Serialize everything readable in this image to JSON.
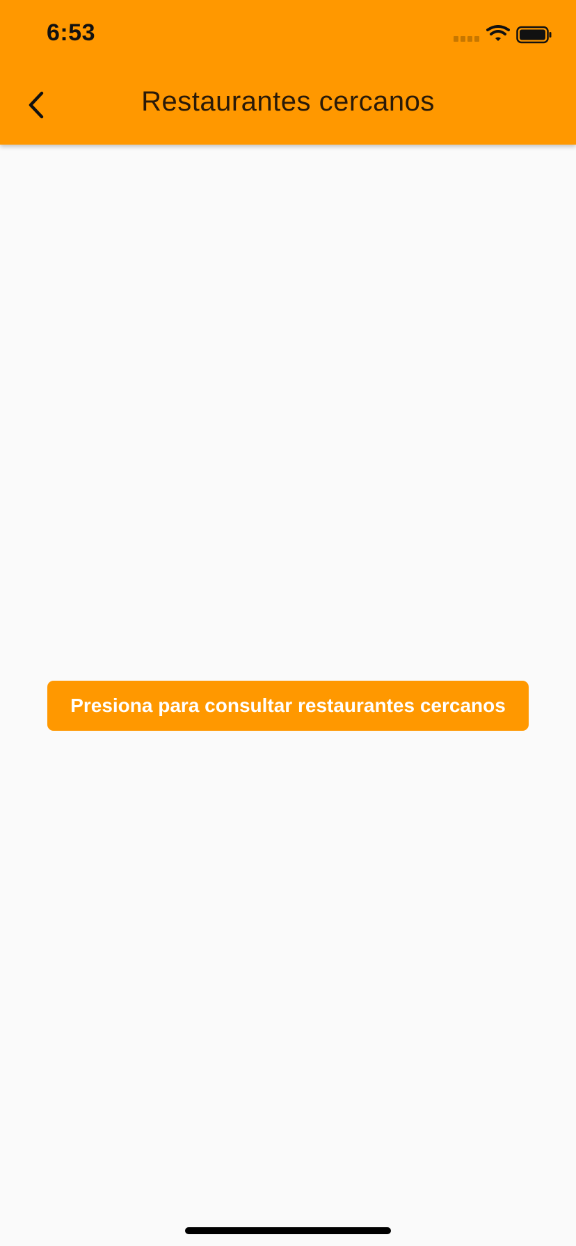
{
  "status_bar": {
    "time": "6:53"
  },
  "header": {
    "title": "Restaurantes cercanos",
    "back_icon": "chevron-left-icon"
  },
  "main": {
    "action_button_label": "Presiona para consultar restaurantes cercanos"
  },
  "colors": {
    "primary": "#ff9800",
    "background": "#fafafa",
    "button_text": "#ffffff"
  },
  "icons": [
    "signal-icon",
    "wifi-icon",
    "battery-icon",
    "chevron-left-icon"
  ]
}
